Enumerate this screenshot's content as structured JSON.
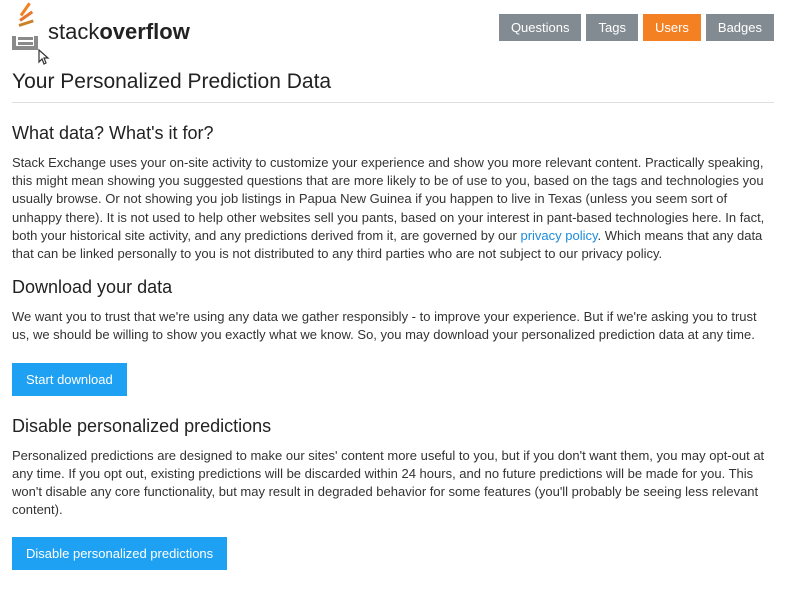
{
  "header": {
    "logo_text_1": "stack",
    "logo_text_2": "overflow"
  },
  "nav": {
    "items": [
      {
        "label": "Questions",
        "active": false
      },
      {
        "label": "Tags",
        "active": false
      },
      {
        "label": "Users",
        "active": true
      },
      {
        "label": "Badges",
        "active": false
      }
    ]
  },
  "page": {
    "title": "Your Personalized Prediction Data"
  },
  "sections": {
    "what": {
      "title": "What data? What's it for?",
      "p1a": "Stack Exchange uses your on-site activity to customize your experience and show you more relevant content. Practically speaking, this might mean showing you suggested questions that are more likely to be of use to you, based on the tags and technologies you usually browse. Or not showing you job listings in Papua New Guinea if you happen to live in Texas (unless you seem sort of unhappy there). It is not used to help other websites sell you pants, based on your interest in pant-based technologies here. In fact, both your historical site activity, and any predictions derived from it, are governed by our ",
      "link": "privacy policy",
      "p1b": ". Which means that any data that can be linked personally to you is not distributed to any third parties who are not subject to our privacy policy."
    },
    "download": {
      "title": "Download your data",
      "p1": "We want you to trust that we're using any data we gather responsibly - to improve your experience. But if we're asking you to trust us, we should be willing to show you exactly what we know. So, you may download your personalized prediction data at any time.",
      "button": "Start download"
    },
    "disable": {
      "title": "Disable personalized predictions",
      "p1": "Personalized predictions are designed to make our sites' content more useful to you, but if you don't want them, you may opt-out at any time. If you opt out, existing predictions will be discarded within 24 hours, and no future predictions will be made for you. This won't disable any core functionality, but may result in degraded behavior for some features (you'll probably be seeing less relevant content).",
      "button": "Disable personalized predictions"
    }
  }
}
